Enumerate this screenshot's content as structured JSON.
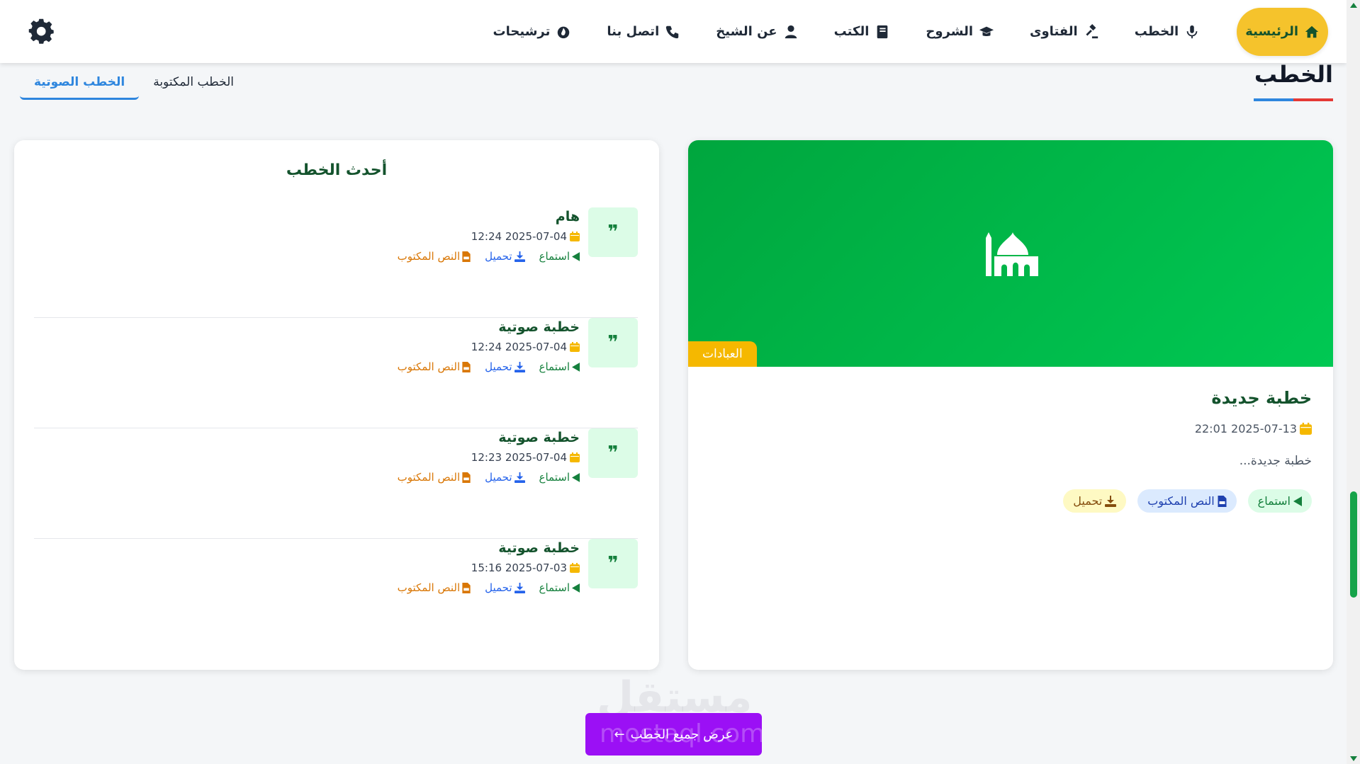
{
  "nav": {
    "items": [
      {
        "label": "الرئيسية",
        "icon": "home-icon"
      },
      {
        "label": "الخطب",
        "icon": "microphone-icon"
      },
      {
        "label": "الفتاوى",
        "icon": "gavel-icon"
      },
      {
        "label": "الشروح",
        "icon": "graduation-cap-icon"
      },
      {
        "label": "الكتب",
        "icon": "book-icon"
      },
      {
        "label": "عن الشيخ",
        "icon": "user-icon"
      },
      {
        "label": "اتصل بنا",
        "icon": "phone-icon"
      },
      {
        "label": "ترشيحات",
        "icon": "fire-icon"
      }
    ],
    "settings_icon": "gear-icon"
  },
  "page": {
    "title": "الخطب",
    "underline_colors": [
      "#e53935",
      "#2e86de"
    ]
  },
  "tabs": [
    {
      "label": "الخطب الصوتية",
      "active": true
    },
    {
      "label": "الخطب المكتوبة",
      "active": false
    }
  ],
  "featured": {
    "category": "العبادات",
    "title": "خطبة جديدة",
    "date": "2025-07-13 22:01",
    "description": "خطبة جديدة...",
    "actions": {
      "listen": "استماع",
      "text": "النص المكتوب",
      "download": "تحميل"
    }
  },
  "latest": {
    "title": "أحدث الخطب",
    "quote_glyph": "❞",
    "items": [
      {
        "title": "هام",
        "date": "2025-07-04 12:24",
        "listen": "استماع",
        "download": "تحميل",
        "text": "النص المكتوب"
      },
      {
        "title": "خطبة صوتية",
        "date": "2025-07-04 12:24",
        "listen": "استماع",
        "download": "تحميل",
        "text": "النص المكتوب"
      },
      {
        "title": "خطبة صوتية",
        "date": "2025-07-04 12:23",
        "listen": "استماع",
        "download": "تحميل",
        "text": "النص المكتوب"
      },
      {
        "title": "خطبة صوتية",
        "date": "2025-07-03 15:16",
        "listen": "استماع",
        "download": "تحميل",
        "text": "النص المكتوب"
      }
    ]
  },
  "view_all": {
    "label": "عرض جميع الخطب",
    "arrow": "←"
  },
  "watermark": {
    "text": "مستقل",
    "sub": "mostaql.com"
  },
  "colors": {
    "primary_green": "#00a63e",
    "accent_yellow": "#f5b800",
    "button_purple": "#9b10f5",
    "link_blue": "#2e86de"
  }
}
